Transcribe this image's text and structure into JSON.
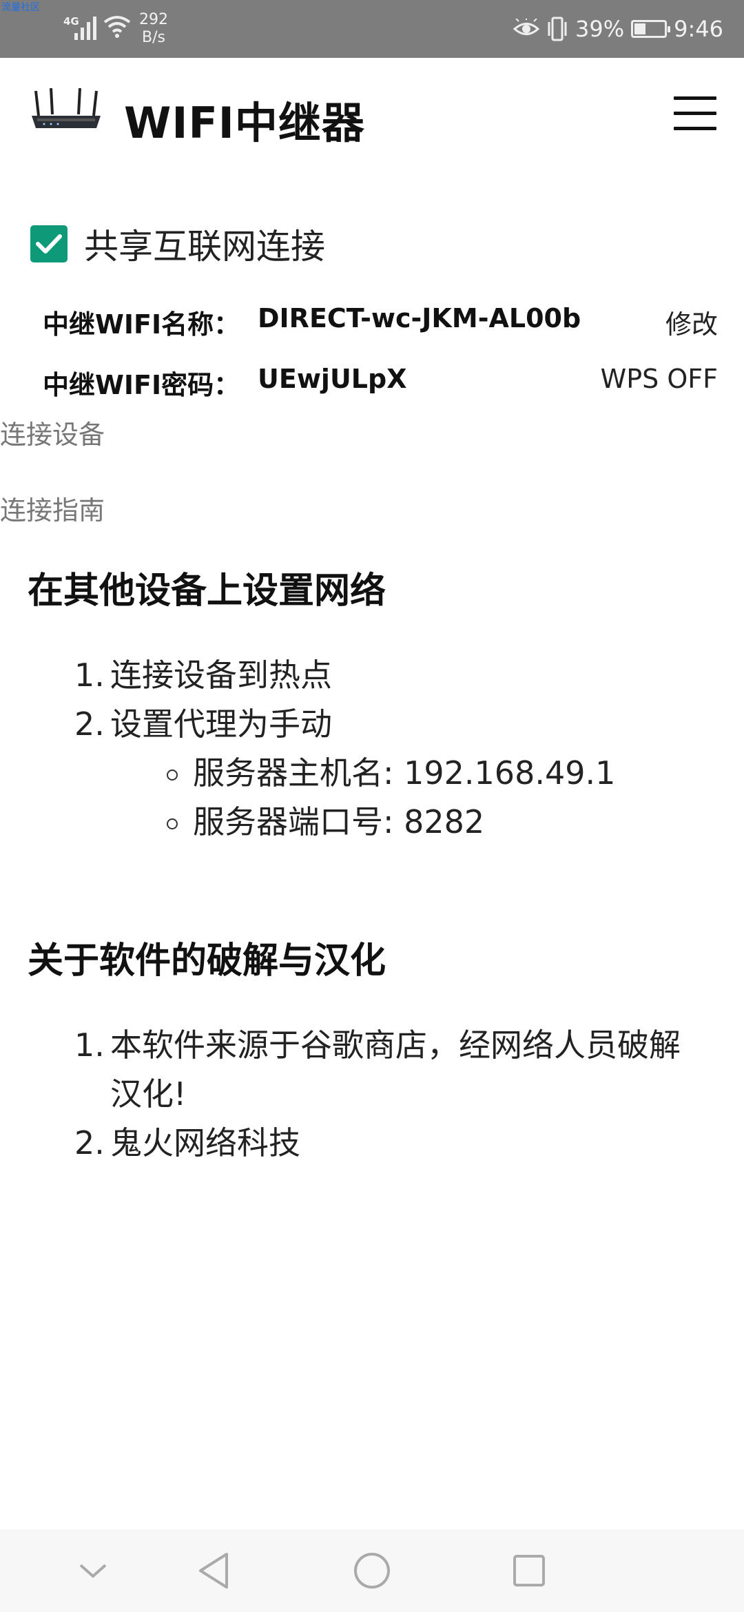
{
  "status_bar": {
    "tiny_text": "流量社区",
    "network": "4G",
    "speed_value": "292",
    "speed_unit": "B/s",
    "battery_percent": "39%",
    "battery_level": 0.39,
    "time": "9:46",
    "icons": [
      "signal-icon",
      "wifi-icon",
      "eye-icon",
      "vibrate-icon",
      "battery-icon"
    ]
  },
  "app_bar": {
    "title": "WIFI中继器",
    "logo_icon": "router-icon",
    "menu_icon": "hamburger-menu-icon"
  },
  "share": {
    "label": "共享互联网连接",
    "checked": true,
    "accent_color": "#0d9a78"
  },
  "wifi_info": {
    "name_label": "中继WIFI名称：",
    "name_value": "DIRECT-wc-JKM-AL00b",
    "name_action": "修改",
    "password_label": "中继WIFI密码：",
    "password_value": "UEwjULpX",
    "password_action": "WPS OFF"
  },
  "sections": {
    "connected_devices": "连接设备",
    "guide": "连接指南"
  },
  "guide": {
    "title": "在其他设备上设置网络",
    "steps": [
      {
        "num": "1.",
        "text": "连接设备到热点"
      },
      {
        "num": "2.",
        "text": "设置代理为手动"
      }
    ],
    "sub_items": [
      "服务器主机名: 192.168.49.1",
      "服务器端口号: 8282"
    ]
  },
  "about": {
    "title": "关于软件的破解与汉化",
    "items": [
      {
        "num": "1.",
        "line1": "本软件来源于谷歌商店，经网络人员破解",
        "line2": "汉化!"
      },
      {
        "num": "2.",
        "line1": "鬼火网络科技"
      }
    ]
  },
  "nav_bar": {
    "icons": [
      "collapse-chevron-icon",
      "back-icon",
      "home-icon",
      "recents-icon"
    ]
  }
}
